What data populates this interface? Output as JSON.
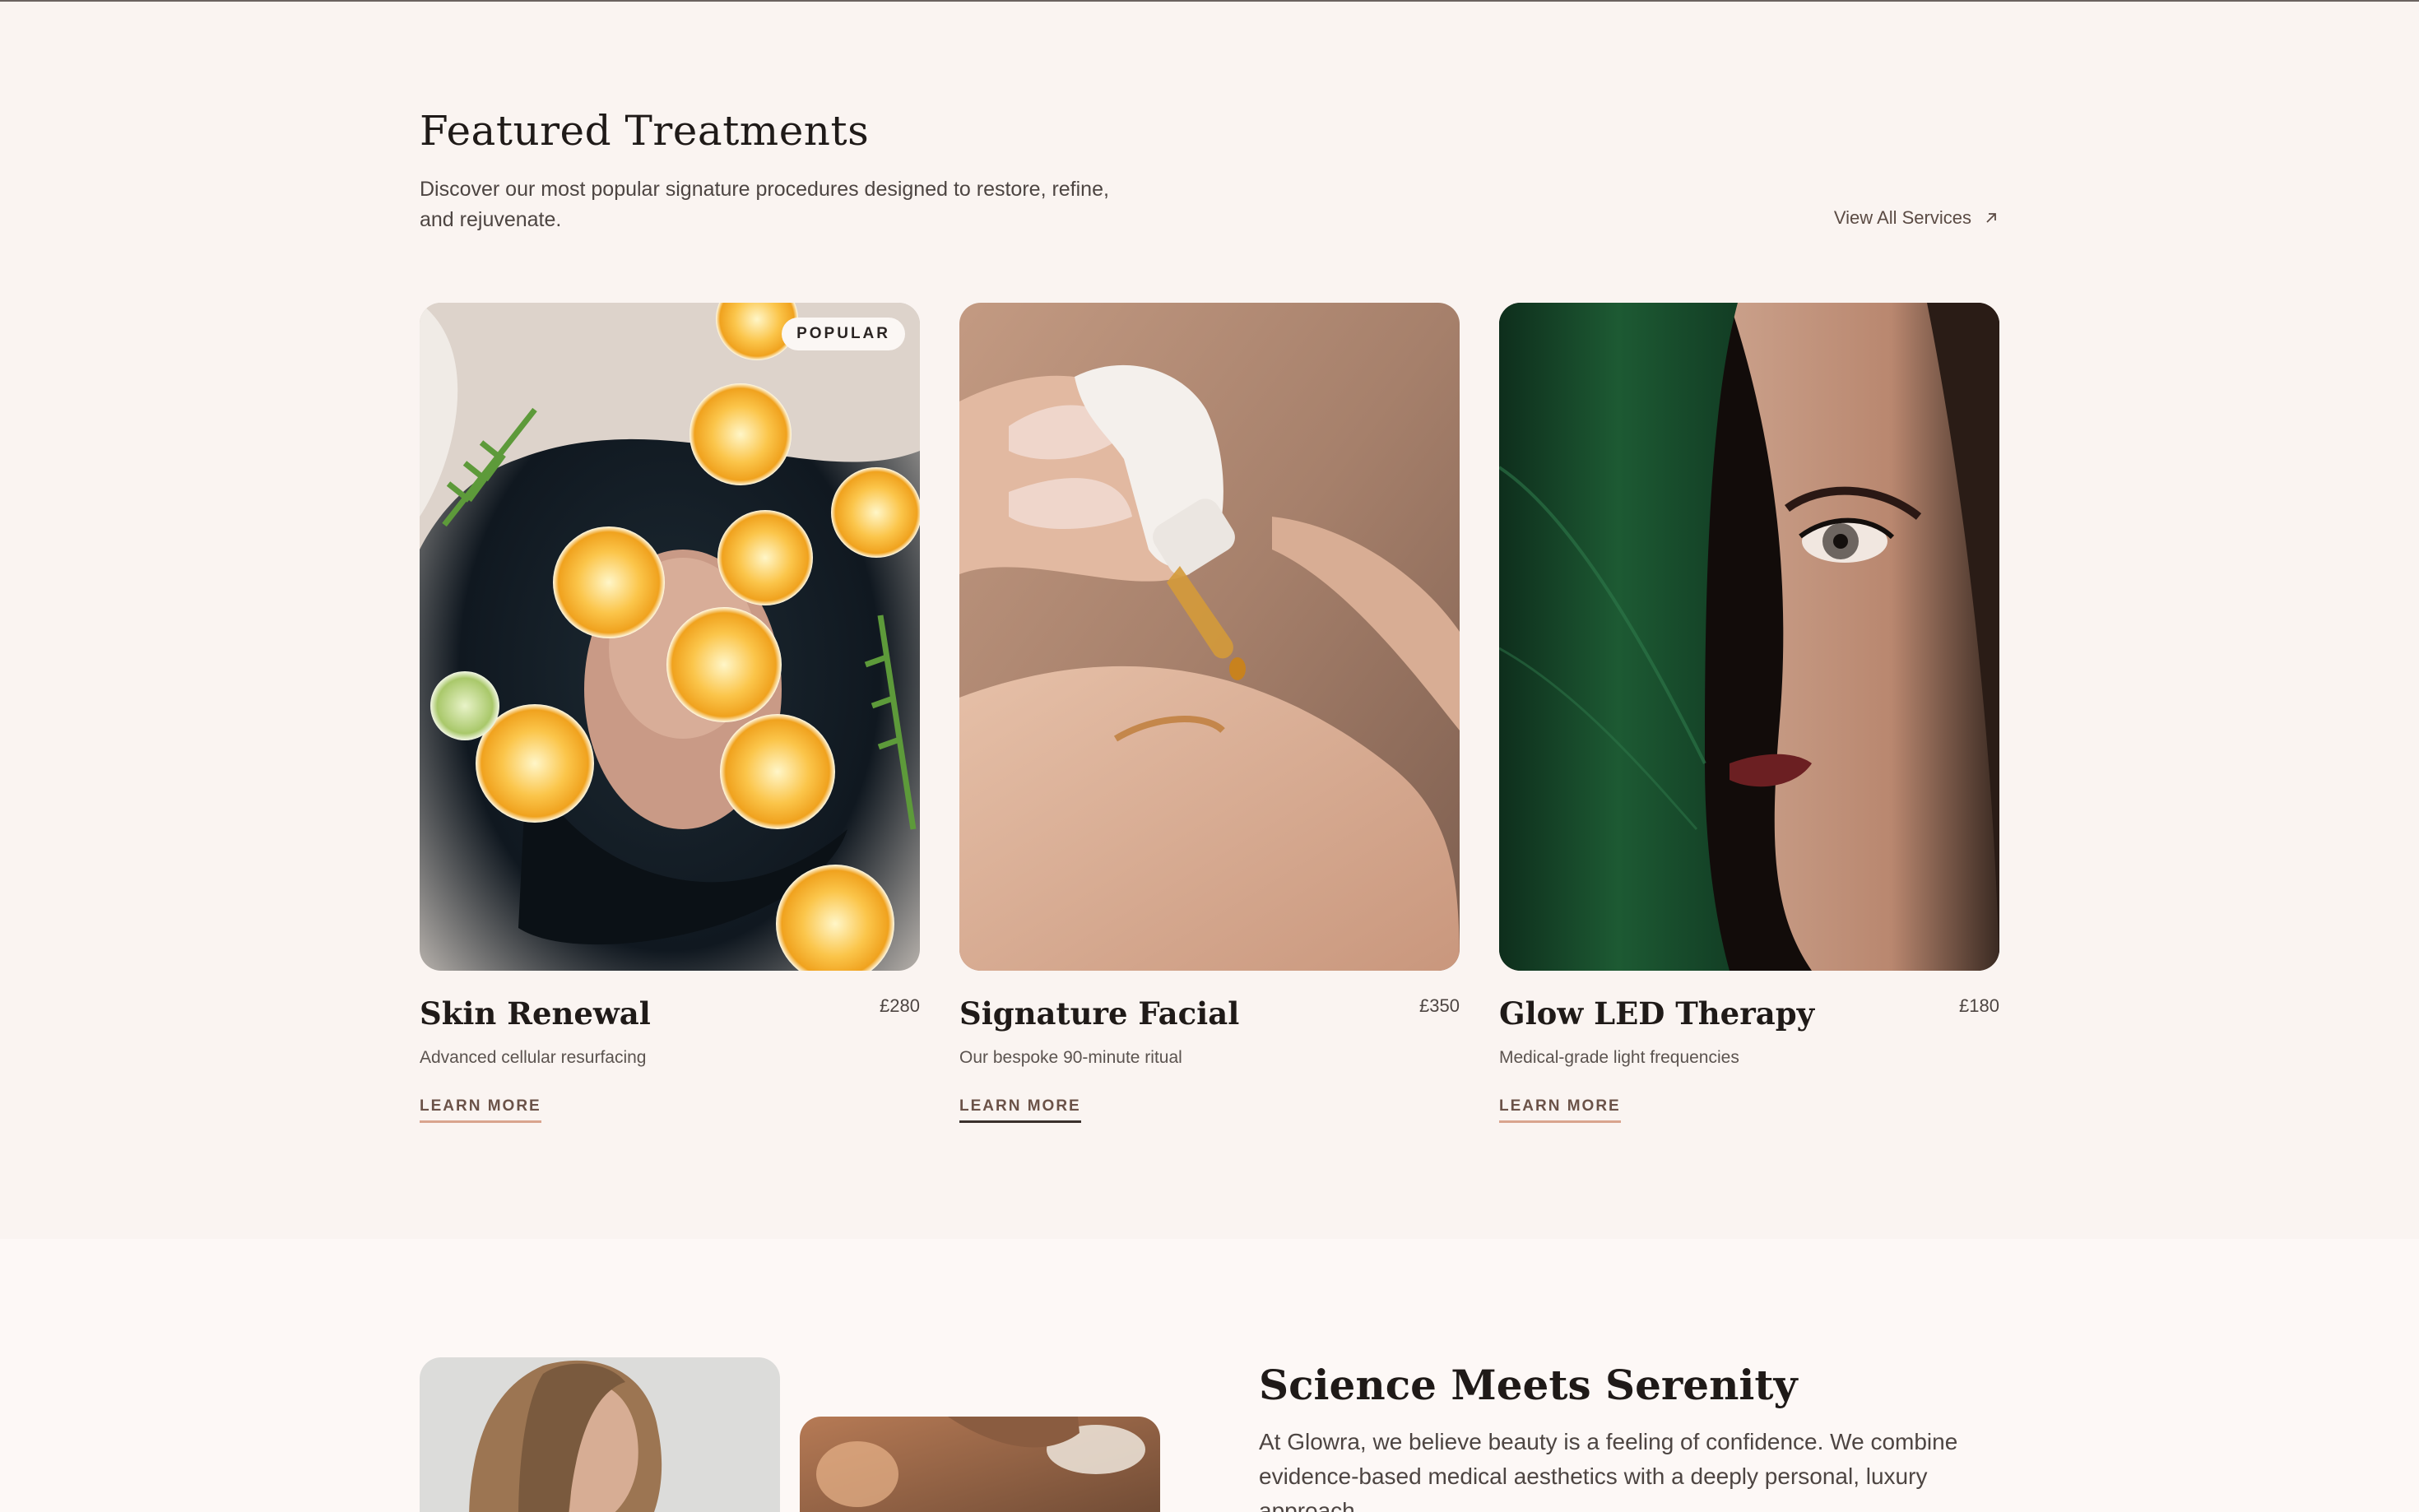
{
  "featured": {
    "title": "Featured Treatments",
    "description": "Discover our most popular signature procedures designed to restore, refine, and rejuvenate.",
    "view_all_label": "View All Services",
    "cards": [
      {
        "title": "Skin Renewal",
        "price": "£280",
        "subtitle": "Advanced cellular resurfacing",
        "cta": "LEARN MORE",
        "badge": "POPULAR",
        "image": "woman-in-water-with-orange-slices"
      },
      {
        "title": "Signature Facial",
        "price": "£350",
        "subtitle": "Our bespoke 90-minute ritual",
        "cta": "LEARN MORE",
        "image": "serum-dropper-on-hand"
      },
      {
        "title": "Glow LED Therapy",
        "price": "£180",
        "subtitle": "Medical-grade light frequencies",
        "cta": "LEARN MORE",
        "image": "woman-face-behind-green-leaf"
      }
    ]
  },
  "science": {
    "title": "Science Meets Serenity",
    "body": "At Glowra, we believe beauty is a feeling of confidence. We combine evidence-based medical aesthetics with a deeply personal, luxury approach."
  },
  "colors": {
    "background": "#faf4f1",
    "accent_underline": "#d9a48e",
    "text_dark": "#1f1a18"
  }
}
